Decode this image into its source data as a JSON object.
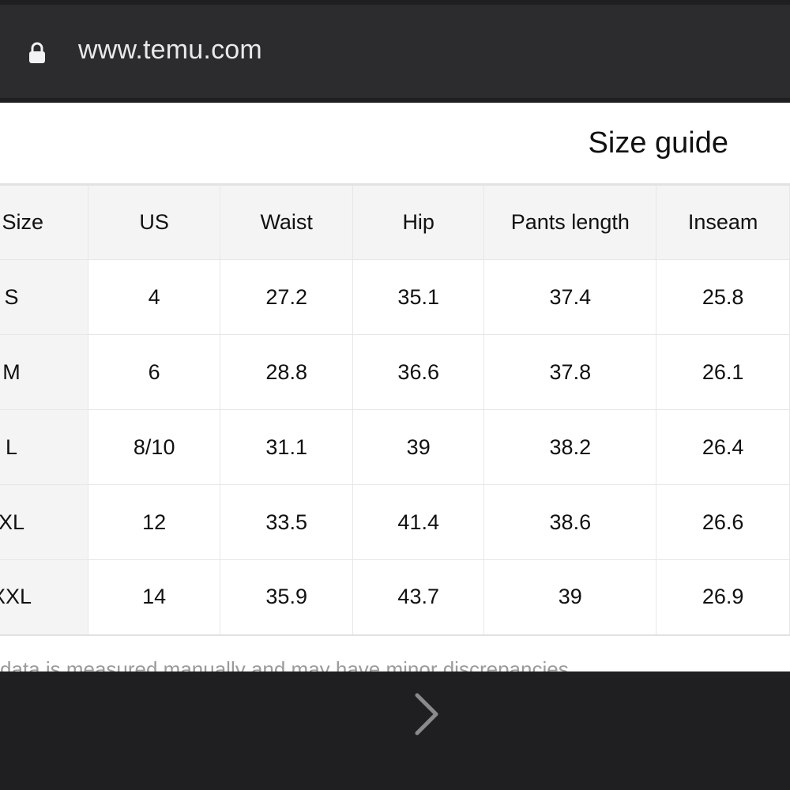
{
  "browser": {
    "url": "www.temu.com",
    "lock_icon": "lock-icon",
    "forward_icon": "chevron-right-icon"
  },
  "sheet": {
    "title": "Size guide",
    "footnote": "data is measured manually and may have minor discrepancies."
  },
  "size_table": {
    "headers": [
      "el Size",
      "US",
      "Waist",
      "Hip",
      "Pants length",
      "Inseam"
    ],
    "rows": [
      [
        "S",
        "4",
        "27.2",
        "35.1",
        "37.4",
        "25.8"
      ],
      [
        "M",
        "6",
        "28.8",
        "36.6",
        "37.8",
        "26.1"
      ],
      [
        "L",
        "8/10",
        "31.1",
        "39",
        "38.2",
        "26.4"
      ],
      [
        "XL",
        "12",
        "33.5",
        "41.4",
        "38.6",
        "26.6"
      ],
      [
        "XXL",
        "14",
        "35.9",
        "43.7",
        "39",
        "26.9"
      ]
    ]
  }
}
